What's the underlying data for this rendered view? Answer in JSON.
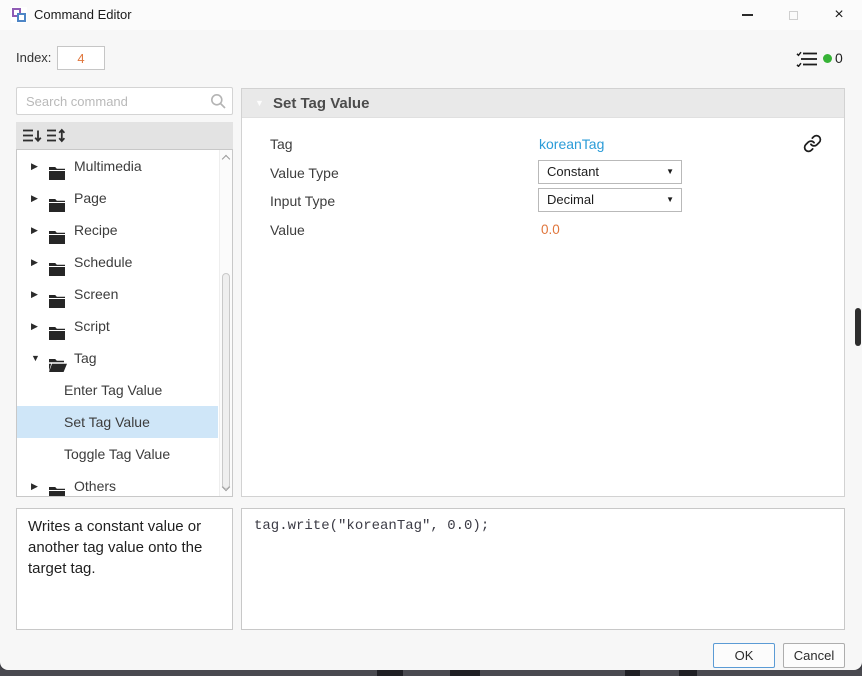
{
  "window": {
    "title": "Command Editor"
  },
  "icons": {
    "close_glyph": "×",
    "collapse_glyph": "▼",
    "dropdown_caret": "▼"
  },
  "header": {
    "index_label": "Index:",
    "index_value": "4",
    "status_count": "0",
    "status_dot_color": "#36b336"
  },
  "sidebar": {
    "search_placeholder": "Search command",
    "tree": [
      {
        "label": "Multimedia",
        "type": "folder",
        "caret": "▶",
        "state": "collapsed",
        "selected": false
      },
      {
        "label": "Page",
        "type": "folder",
        "caret": "▶",
        "state": "collapsed",
        "selected": false
      },
      {
        "label": "Recipe",
        "type": "folder",
        "caret": "▶",
        "state": "collapsed",
        "selected": false
      },
      {
        "label": "Schedule",
        "type": "folder",
        "caret": "▶",
        "state": "collapsed",
        "selected": false
      },
      {
        "label": "Screen",
        "type": "folder",
        "caret": "▶",
        "state": "collapsed",
        "selected": false
      },
      {
        "label": "Script",
        "type": "folder",
        "caret": "▶",
        "state": "collapsed",
        "selected": false
      },
      {
        "label": "Tag",
        "type": "folder",
        "caret": "▼",
        "state": "expanded",
        "selected": false
      },
      {
        "label": "Enter Tag Value",
        "type": "command",
        "selected": false
      },
      {
        "label": "Set Tag Value",
        "type": "command",
        "selected": true
      },
      {
        "label": "Toggle Tag Value",
        "type": "command",
        "selected": false
      },
      {
        "label": "Others",
        "type": "folder",
        "caret": "▶",
        "state": "collapsed",
        "selected": false
      }
    ],
    "description": "Writes a constant value or another tag value onto the target tag."
  },
  "editor": {
    "panel_title": "Set Tag Value",
    "fields": {
      "tag": {
        "label": "Tag",
        "value": "koreanTag"
      },
      "value_type": {
        "label": "Value Type",
        "value": "Constant"
      },
      "input_type": {
        "label": "Input Type",
        "value": "Decimal"
      },
      "value": {
        "label": "Value",
        "value": "0.0"
      }
    },
    "code": "tag.write(\"koreanTag\", 0.0);"
  },
  "footer": {
    "ok_label": "OK",
    "cancel_label": "Cancel"
  },
  "colors": {
    "link_blue": "#2b9cd8",
    "value_orange": "#e0763c",
    "selection_blue": "#cfe6f8",
    "status_green": "#36b336",
    "ok_border_blue": "#5b9bd5"
  }
}
